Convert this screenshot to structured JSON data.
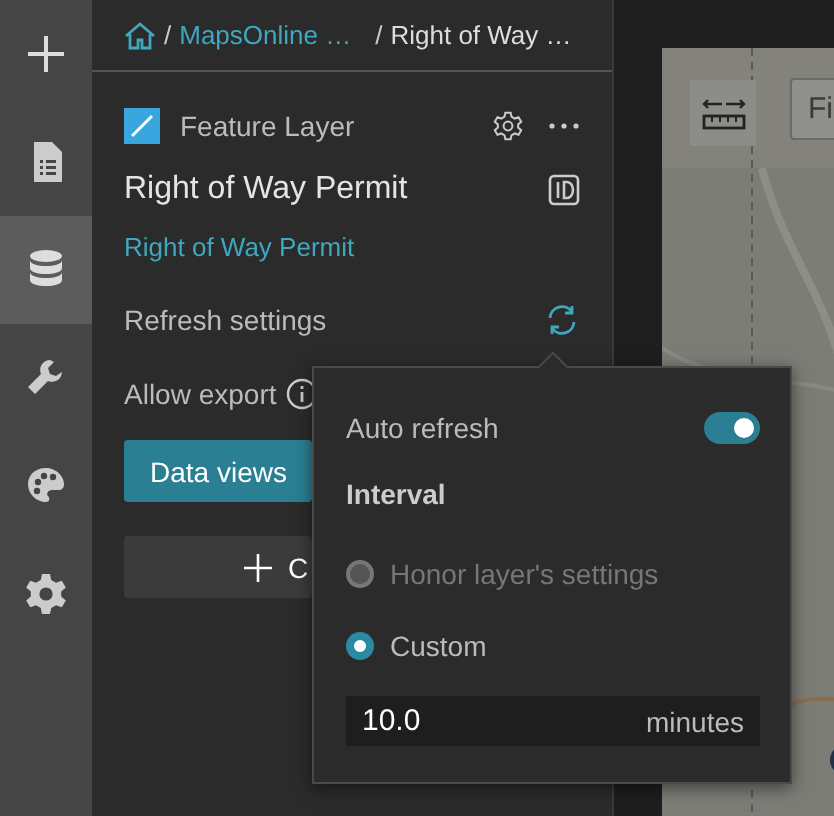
{
  "sidebar": {
    "items": [
      {
        "kind": "add",
        "selected": false
      },
      {
        "kind": "document",
        "selected": false
      },
      {
        "kind": "database",
        "selected": true
      },
      {
        "kind": "wrench",
        "selected": false
      },
      {
        "kind": "palette",
        "selected": false
      },
      {
        "kind": "gear",
        "selected": false
      }
    ]
  },
  "breadcrumb": [
    {
      "separator": "/",
      "label": "MapsOnline …"
    },
    {
      "separator": "/",
      "label": "Right of Way …"
    }
  ],
  "layer": {
    "type": "Feature Layer",
    "title": "Right of Way Permit",
    "link": "Right of Way Permit"
  },
  "settings": {
    "refresh": "Refresh settings",
    "export": "Allow export"
  },
  "buttons": {
    "data_views": "Data views",
    "create": "C"
  },
  "popover": {
    "auto_refresh": {
      "label": "Auto refresh",
      "on": true
    },
    "interval": "Interval",
    "options": [
      {
        "label": "Honor layer's settings",
        "selected": false,
        "disabled": true
      },
      {
        "label": "Custom",
        "selected": true,
        "disabled": false
      }
    ],
    "value": "10.0",
    "unit": "minutes"
  },
  "map": {
    "kind": "picture",
    "button": "Fi"
  }
}
